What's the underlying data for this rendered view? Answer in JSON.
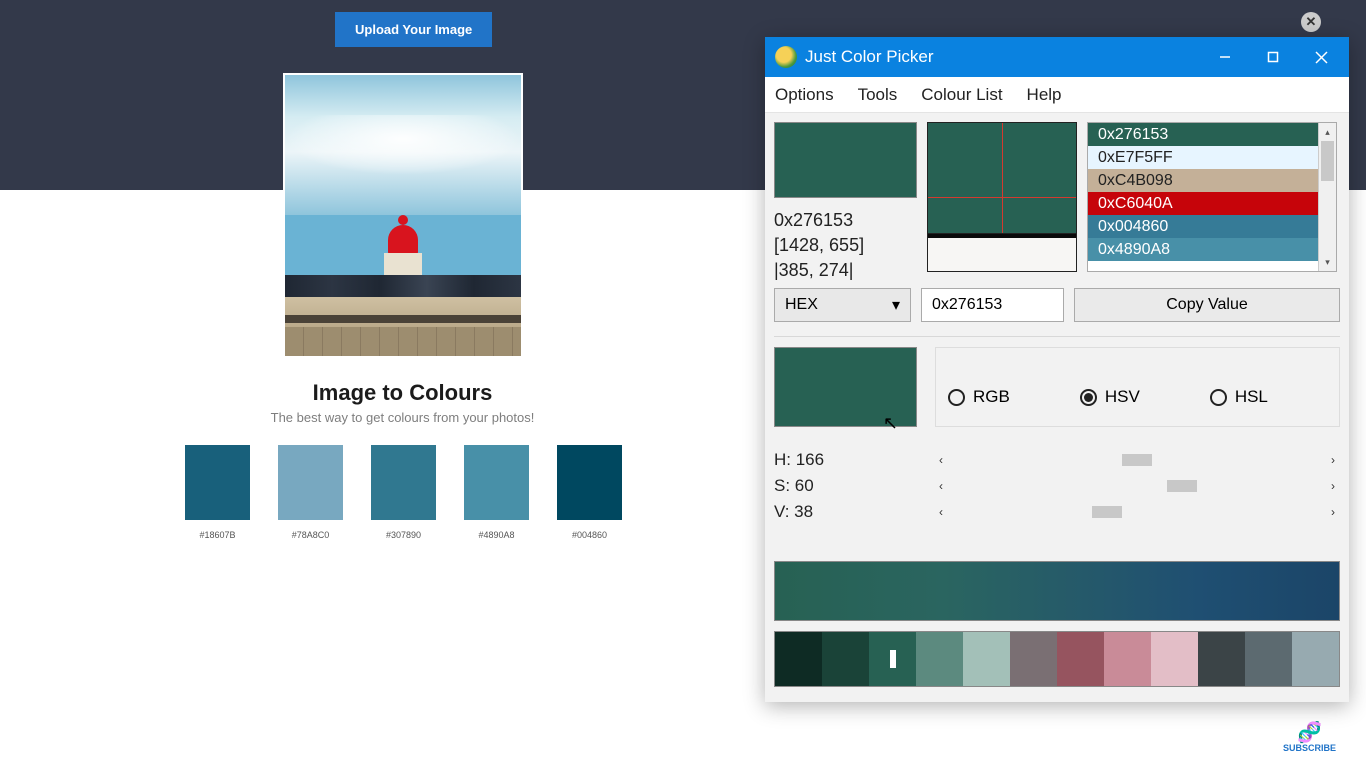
{
  "page": {
    "upload_label": "Upload Your Image",
    "title": "Image to Colours",
    "subtitle": "The best way to get colours from your photos!",
    "swatches": [
      {
        "hex": "#18607B",
        "label": "#18607B"
      },
      {
        "hex": "#78A8C0",
        "label": "#78A8C0"
      },
      {
        "hex": "#307890",
        "label": "#307890"
      },
      {
        "hex": "#4890A8",
        "label": "#4890A8"
      },
      {
        "hex": "#004860",
        "label": "#004860"
      }
    ],
    "subscribe": "SUBSCRIBE"
  },
  "picker": {
    "title": "Just Color Picker",
    "menu": {
      "options": "Options",
      "tools": "Tools",
      "colour_list": "Colour List",
      "help": "Help"
    },
    "current_hex": "0x276153",
    "current_coords": "[1428, 655]",
    "current_area": "|385, 274|",
    "format": "HEX",
    "value_input": "0x276153",
    "copy_label": "Copy Value",
    "color_models": {
      "rgb": "RGB",
      "hsv": "HSV",
      "hsl": "HSL"
    },
    "selected_model": "HSV",
    "hsv": {
      "h_label": "H: 166",
      "s_label": "S: 60",
      "v_label": "V: 38",
      "h": 166,
      "s": 60,
      "v": 38
    },
    "history": [
      {
        "code": "0x276153",
        "bg": "#276153",
        "fg": "#ffffff"
      },
      {
        "code": "0xE7F5FF",
        "bg": "#E7F5FF",
        "fg": "#222222"
      },
      {
        "code": "0xC4B098",
        "bg": "#C4B098",
        "fg": "#222222"
      },
      {
        "code": "0xC6040A",
        "bg": "#C6040A",
        "fg": "#ffffff"
      },
      {
        "code": "0x004860",
        "bg": "#367b97",
        "fg": "#ffffff"
      },
      {
        "code": "0x4890A8",
        "bg": "#4890A8",
        "fg": "#ffffff"
      }
    ],
    "shades": [
      "#0e2b24",
      "#1a4338",
      "#276153",
      "#5c8a7f",
      "#a3c0b8",
      "#7a6f73",
      "#96545f",
      "#c98b98",
      "#e3bec7",
      "#3b4447",
      "#5c6a70",
      "#97aab0"
    ]
  }
}
